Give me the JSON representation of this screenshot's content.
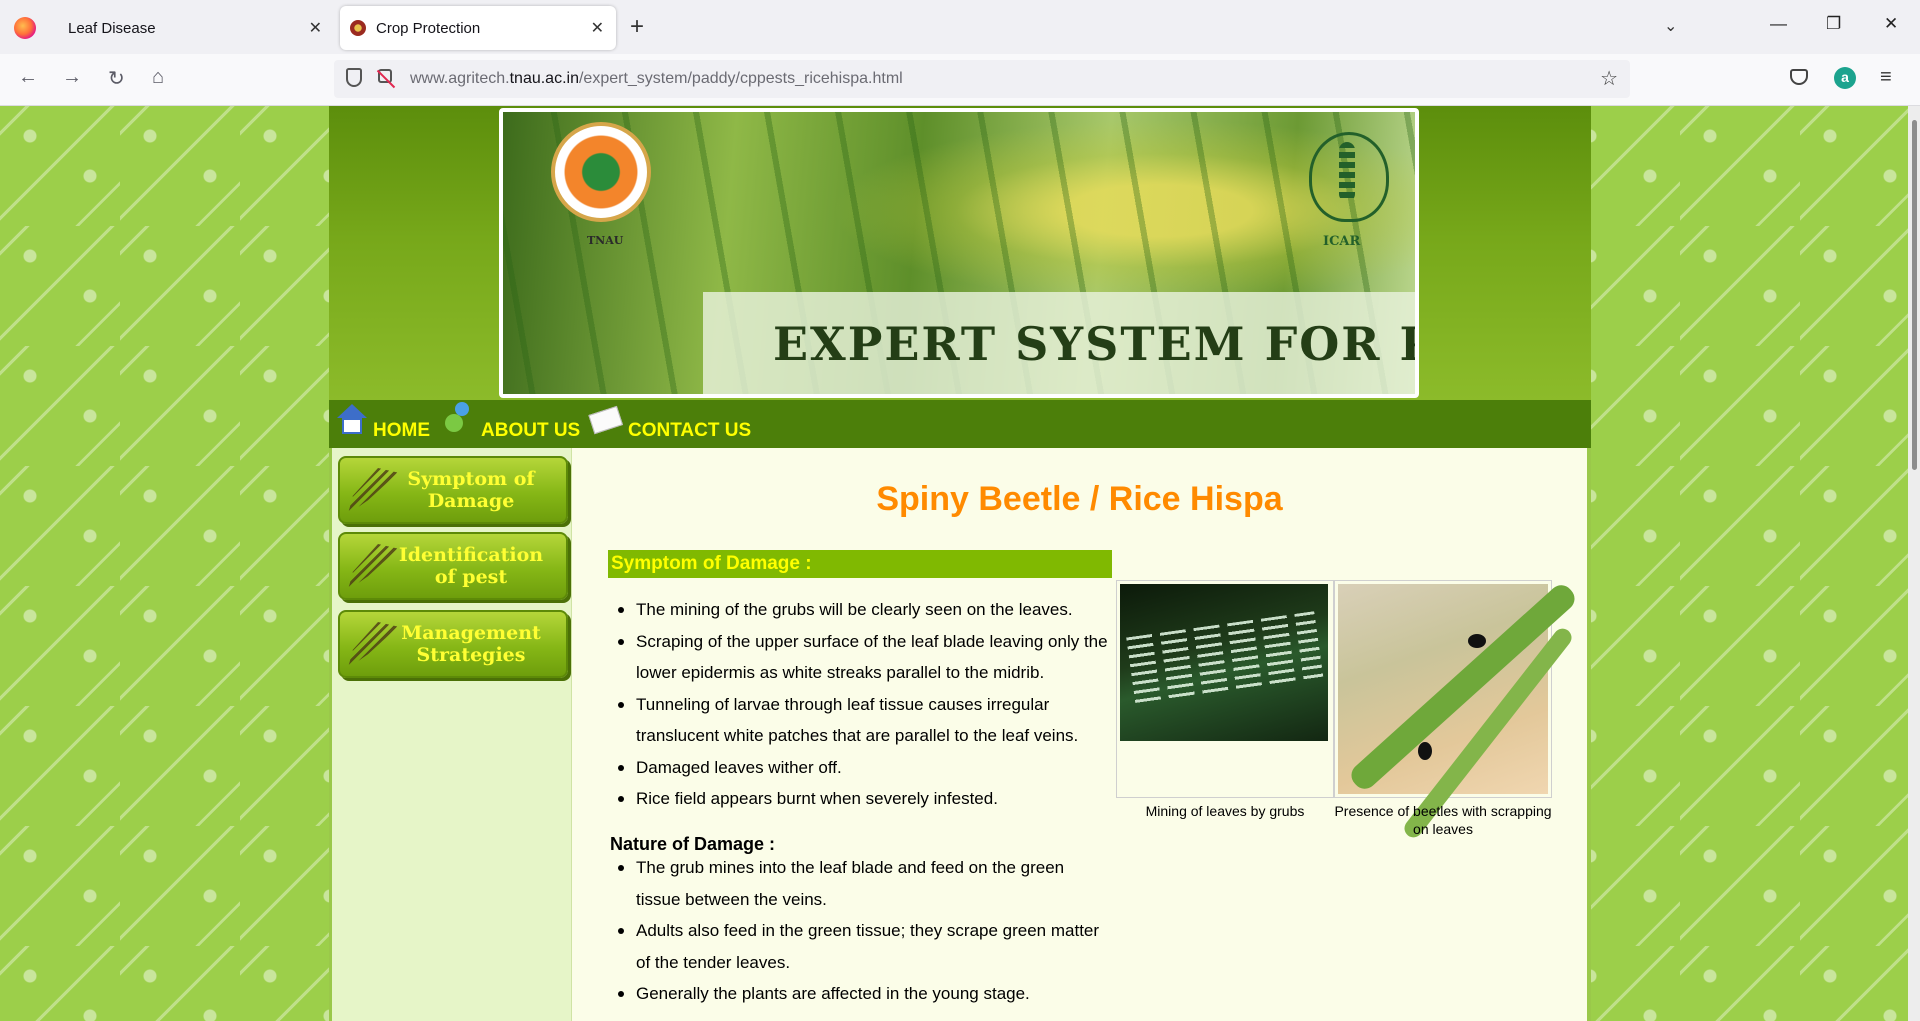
{
  "browser": {
    "tabs": [
      {
        "title": "Leaf Disease",
        "close": "✕"
      },
      {
        "title": "Crop Protection",
        "close": "✕"
      }
    ],
    "new_tab": "+",
    "url_domain_prefix": "www.agritech.",
    "url_domain": "tnau.ac.in",
    "url_path": "/expert_system/paddy/cppests_ricehispa.html",
    "account_initial": "a",
    "icons": [
      "back-icon",
      "forward-icon",
      "reload-icon",
      "home-icon",
      "shield-icon",
      "lock-icon",
      "star-icon",
      "pocket-icon",
      "menu-icon"
    ]
  },
  "header": {
    "banner_title": "EXPERT SYSTEM FOR PADDY",
    "tnau_label": "TNAU",
    "icar_label": "ICAR"
  },
  "nav": {
    "home": "HOME",
    "about": "ABOUT US",
    "contact": "CONTACT US"
  },
  "sidebar": {
    "items": [
      {
        "line1": "Symptom of",
        "line2": "Damage"
      },
      {
        "line1": "Identification",
        "line2": "of pest"
      },
      {
        "line1": "Management",
        "line2": "Strategies"
      }
    ]
  },
  "content": {
    "title": "Spiny Beetle / Rice Hispa",
    "section_heading": "Symptom of Damage :",
    "symptoms": [
      "The mining of the grubs will be clearly seen on the leaves.",
      "Scraping of the upper surface of the leaf blade leaving only the lower epidermis as white streaks parallel to the midrib.",
      "Tunneling of larvae through leaf tissue causes irregular translucent white patches that are parallel to the leaf veins.",
      "Damaged leaves wither off.",
      "Rice field appears burnt when severely infested."
    ],
    "nature_heading": "Nature of Damage :",
    "nature": [
      "The grub mines into the leaf blade and feed on the green tissue between the veins.",
      "Adults also feed in the green tissue; they scrape green matter of the tender leaves.",
      "Generally the plants are affected in the young stage."
    ],
    "captions": [
      "Mining of leaves by grubs",
      "Presence of beetles with scrapping on leaves"
    ]
  },
  "colors": {
    "title_orange": "#ff8a00",
    "nav_green": "#4c7f0a",
    "heading_green": "#80b901",
    "nav_text_yellow": "#ffff00"
  }
}
